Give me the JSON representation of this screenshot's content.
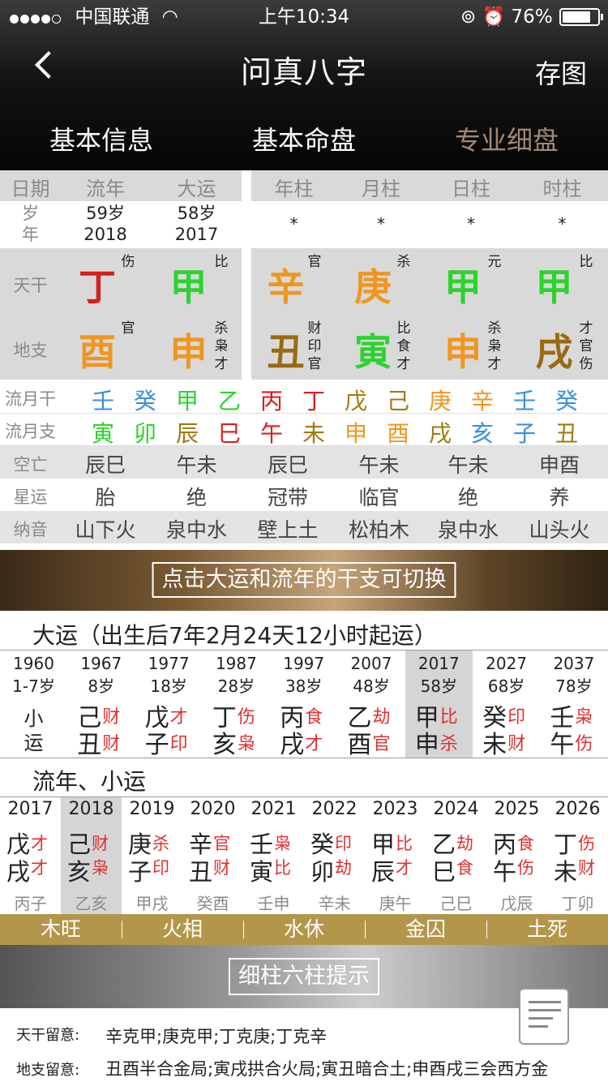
{
  "status": {
    "carrier": "中国联通",
    "time": "上午10:34",
    "battery": "76%"
  },
  "header": {
    "title": "问真八字",
    "save": "存图"
  },
  "tabs": [
    {
      "label": "基本信息"
    },
    {
      "label": "基本命盘"
    },
    {
      "label": "专业细盘"
    }
  ],
  "colhead": [
    "日期",
    "流年",
    "大运",
    "年柱",
    "月柱",
    "日柱",
    "时柱"
  ],
  "age": {
    "label1": "岁",
    "label2": "年",
    "ln_age": "59岁",
    "ln_year": "2018",
    "dy_age": "58岁",
    "dy_year": "2017",
    "stars": [
      "*",
      "*",
      "*",
      "*"
    ]
  },
  "tiangan": {
    "label": "天干",
    "chars": [
      {
        "t": "丁",
        "s": "伤",
        "color": "#d81e1e"
      },
      {
        "t": "甲",
        "s": "比",
        "color": "#2bd42b"
      },
      {
        "t": "辛",
        "s": "官",
        "color": "#f0961e"
      },
      {
        "t": "庚",
        "s": "杀",
        "color": "#f0961e"
      },
      {
        "t": "甲",
        "s": "元",
        "color": "#2bd42b"
      },
      {
        "t": "甲",
        "s": "比",
        "color": "#2bd42b"
      }
    ]
  },
  "dizhi": {
    "label": "地支",
    "chars": [
      {
        "t": "酉",
        "s": [
          "官"
        ],
        "color": "#f0961e"
      },
      {
        "t": "申",
        "s": [
          "杀",
          "枭",
          "才"
        ],
        "color": "#f0961e"
      },
      {
        "t": "丑",
        "s": [
          "财",
          "印",
          "官"
        ],
        "color": "#9a6a12"
      },
      {
        "t": "寅",
        "s": [
          "比",
          "食",
          "才"
        ],
        "color": "#2bd42b"
      },
      {
        "t": "申",
        "s": [
          "杀",
          "枭",
          "才"
        ],
        "color": "#f0961e"
      },
      {
        "t": "戌",
        "s": [
          "才",
          "官",
          "伤"
        ],
        "color": "#9a6a12"
      }
    ]
  },
  "liuyuegan": {
    "label": "流月干",
    "chars": [
      {
        "t": "壬",
        "c": "#3a8ee0"
      },
      {
        "t": "癸",
        "c": "#3a8ee0"
      },
      {
        "t": "甲",
        "c": "#2bd42b"
      },
      {
        "t": "乙",
        "c": "#2bd42b"
      },
      {
        "t": "丙",
        "c": "#d81e1e"
      },
      {
        "t": "丁",
        "c": "#d81e1e"
      },
      {
        "t": "戊",
        "c": "#a07a10"
      },
      {
        "t": "己",
        "c": "#a07a10"
      },
      {
        "t": "庚",
        "c": "#f0961e"
      },
      {
        "t": "辛",
        "c": "#f0961e"
      },
      {
        "t": "壬",
        "c": "#3a8ee0"
      },
      {
        "t": "癸",
        "c": "#3a8ee0"
      }
    ]
  },
  "liuyuezhi": {
    "label": "流月支",
    "chars": [
      {
        "t": "寅",
        "c": "#2bd42b"
      },
      {
        "t": "卯",
        "c": "#2bd42b"
      },
      {
        "t": "辰",
        "c": "#a07a10"
      },
      {
        "t": "巳",
        "c": "#d81e1e"
      },
      {
        "t": "午",
        "c": "#d81e1e"
      },
      {
        "t": "未",
        "c": "#a07a10"
      },
      {
        "t": "申",
        "c": "#f0961e"
      },
      {
        "t": "酉",
        "c": "#f0961e"
      },
      {
        "t": "戌",
        "c": "#a07a10"
      },
      {
        "t": "亥",
        "c": "#3a8ee0"
      },
      {
        "t": "子",
        "c": "#3a8ee0"
      },
      {
        "t": "丑",
        "c": "#a07a10"
      }
    ]
  },
  "kongwang": {
    "label": "空亡",
    "vals": [
      "辰巳",
      "午未",
      "辰巳",
      "午未",
      "午未",
      "申酉"
    ]
  },
  "xingyun": {
    "label": "星运",
    "vals": [
      "胎",
      "绝",
      "冠带",
      "临官",
      "绝",
      "养"
    ]
  },
  "nayin": {
    "label": "纳音",
    "vals": [
      "山下火",
      "泉中水",
      "壁上土",
      "松柏木",
      "泉中水",
      "山头火"
    ]
  },
  "banner1": "点击大运和流年的干支可切换",
  "dayun": {
    "title": "大运（出生后7年2月24天12小时起运）",
    "cols": [
      {
        "year": "1960",
        "age": "1-7岁",
        "gan": "小",
        "gs": "",
        "zhi": "运",
        "zs": ""
      },
      {
        "year": "1967",
        "age": "8岁",
        "gan": "己",
        "gs": "财",
        "zhi": "丑",
        "zs": "财"
      },
      {
        "year": "1977",
        "age": "18岁",
        "gan": "戊",
        "gs": "才",
        "zhi": "子",
        "zs": "印"
      },
      {
        "year": "1987",
        "age": "28岁",
        "gan": "丁",
        "gs": "伤",
        "zhi": "亥",
        "zs": "枭"
      },
      {
        "year": "1997",
        "age": "38岁",
        "gan": "丙",
        "gs": "食",
        "zhi": "戌",
        "zs": "才"
      },
      {
        "year": "2007",
        "age": "48岁",
        "gan": "乙",
        "gs": "劫",
        "zhi": "酉",
        "zs": "官"
      },
      {
        "year": "2017",
        "age": "58岁",
        "gan": "甲",
        "gs": "比",
        "zhi": "申",
        "zs": "杀"
      },
      {
        "year": "2027",
        "age": "68岁",
        "gan": "癸",
        "gs": "印",
        "zhi": "未",
        "zs": "财"
      },
      {
        "year": "2037",
        "age": "78岁",
        "gan": "壬",
        "gs": "枭",
        "zhi": "午",
        "zs": "伤"
      }
    ]
  },
  "liunian": {
    "title": "流年、小运",
    "cols": [
      {
        "year": "2017",
        "gan": "戊",
        "gs": "才",
        "zhi": "戌",
        "zs": "才",
        "xy": "丙子"
      },
      {
        "year": "2018",
        "gan": "己",
        "gs": "财",
        "zhi": "亥",
        "zs": "枭",
        "xy": "乙亥"
      },
      {
        "year": "2019",
        "gan": "庚",
        "gs": "杀",
        "zhi": "子",
        "zs": "印",
        "xy": "甲戌"
      },
      {
        "year": "2020",
        "gan": "辛",
        "gs": "官",
        "zhi": "丑",
        "zs": "财",
        "xy": "癸酉"
      },
      {
        "year": "2021",
        "gan": "壬",
        "gs": "枭",
        "zhi": "寅",
        "zs": "比",
        "xy": "壬申"
      },
      {
        "year": "2022",
        "gan": "癸",
        "gs": "印",
        "zhi": "卯",
        "zs": "劫",
        "xy": "辛未"
      },
      {
        "year": "2023",
        "gan": "甲",
        "gs": "比",
        "zhi": "辰",
        "zs": "才",
        "xy": "庚午"
      },
      {
        "year": "2024",
        "gan": "乙",
        "gs": "劫",
        "zhi": "巳",
        "zs": "食",
        "xy": "己巳"
      },
      {
        "year": "2025",
        "gan": "丙",
        "gs": "食",
        "zhi": "午",
        "zs": "伤",
        "xy": "戊辰"
      },
      {
        "year": "2026",
        "gan": "丁",
        "gs": "伤",
        "zhi": "未",
        "zs": "财",
        "xy": "丁卯"
      }
    ]
  },
  "wuxing": [
    "木旺",
    "火相",
    "水休",
    "金囚",
    "土死"
  ],
  "banner2": "细柱六柱提示",
  "tips": {
    "tg_label": "天干留意:",
    "tg": "辛克甲;庚克甲;丁克庚;丁克辛",
    "dz_label": "地支留意:",
    "dz": "丑酉半合金局;寅戌拱合火局;寅丑暗合土;申酉戌三会西方金"
  }
}
